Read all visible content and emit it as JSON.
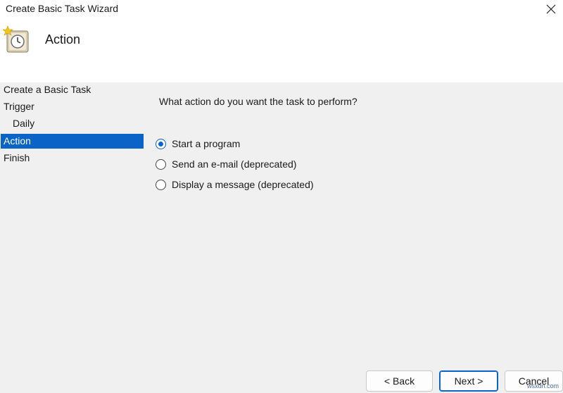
{
  "window": {
    "title": "Create Basic Task Wizard"
  },
  "header": {
    "title": "Action",
    "icon": "task-scheduler-clock-icon"
  },
  "nav": {
    "items": [
      {
        "label": "Create a Basic Task"
      },
      {
        "label": "Trigger"
      },
      {
        "label": "Daily"
      },
      {
        "label": "Action"
      },
      {
        "label": "Finish"
      }
    ],
    "selected": "Action"
  },
  "main": {
    "question": "What action do you want the task to perform?",
    "options": [
      {
        "label": "Start a program",
        "checked": true
      },
      {
        "label": "Send an e-mail (deprecated)",
        "checked": false
      },
      {
        "label": "Display a message (deprecated)",
        "checked": false
      }
    ]
  },
  "buttons": {
    "back": "< Back",
    "next": "Next >",
    "cancel": "Cancel"
  },
  "watermark": "wsxdn.com",
  "colors": {
    "accent": "#0a64c8",
    "background": "#f0f0f0"
  }
}
